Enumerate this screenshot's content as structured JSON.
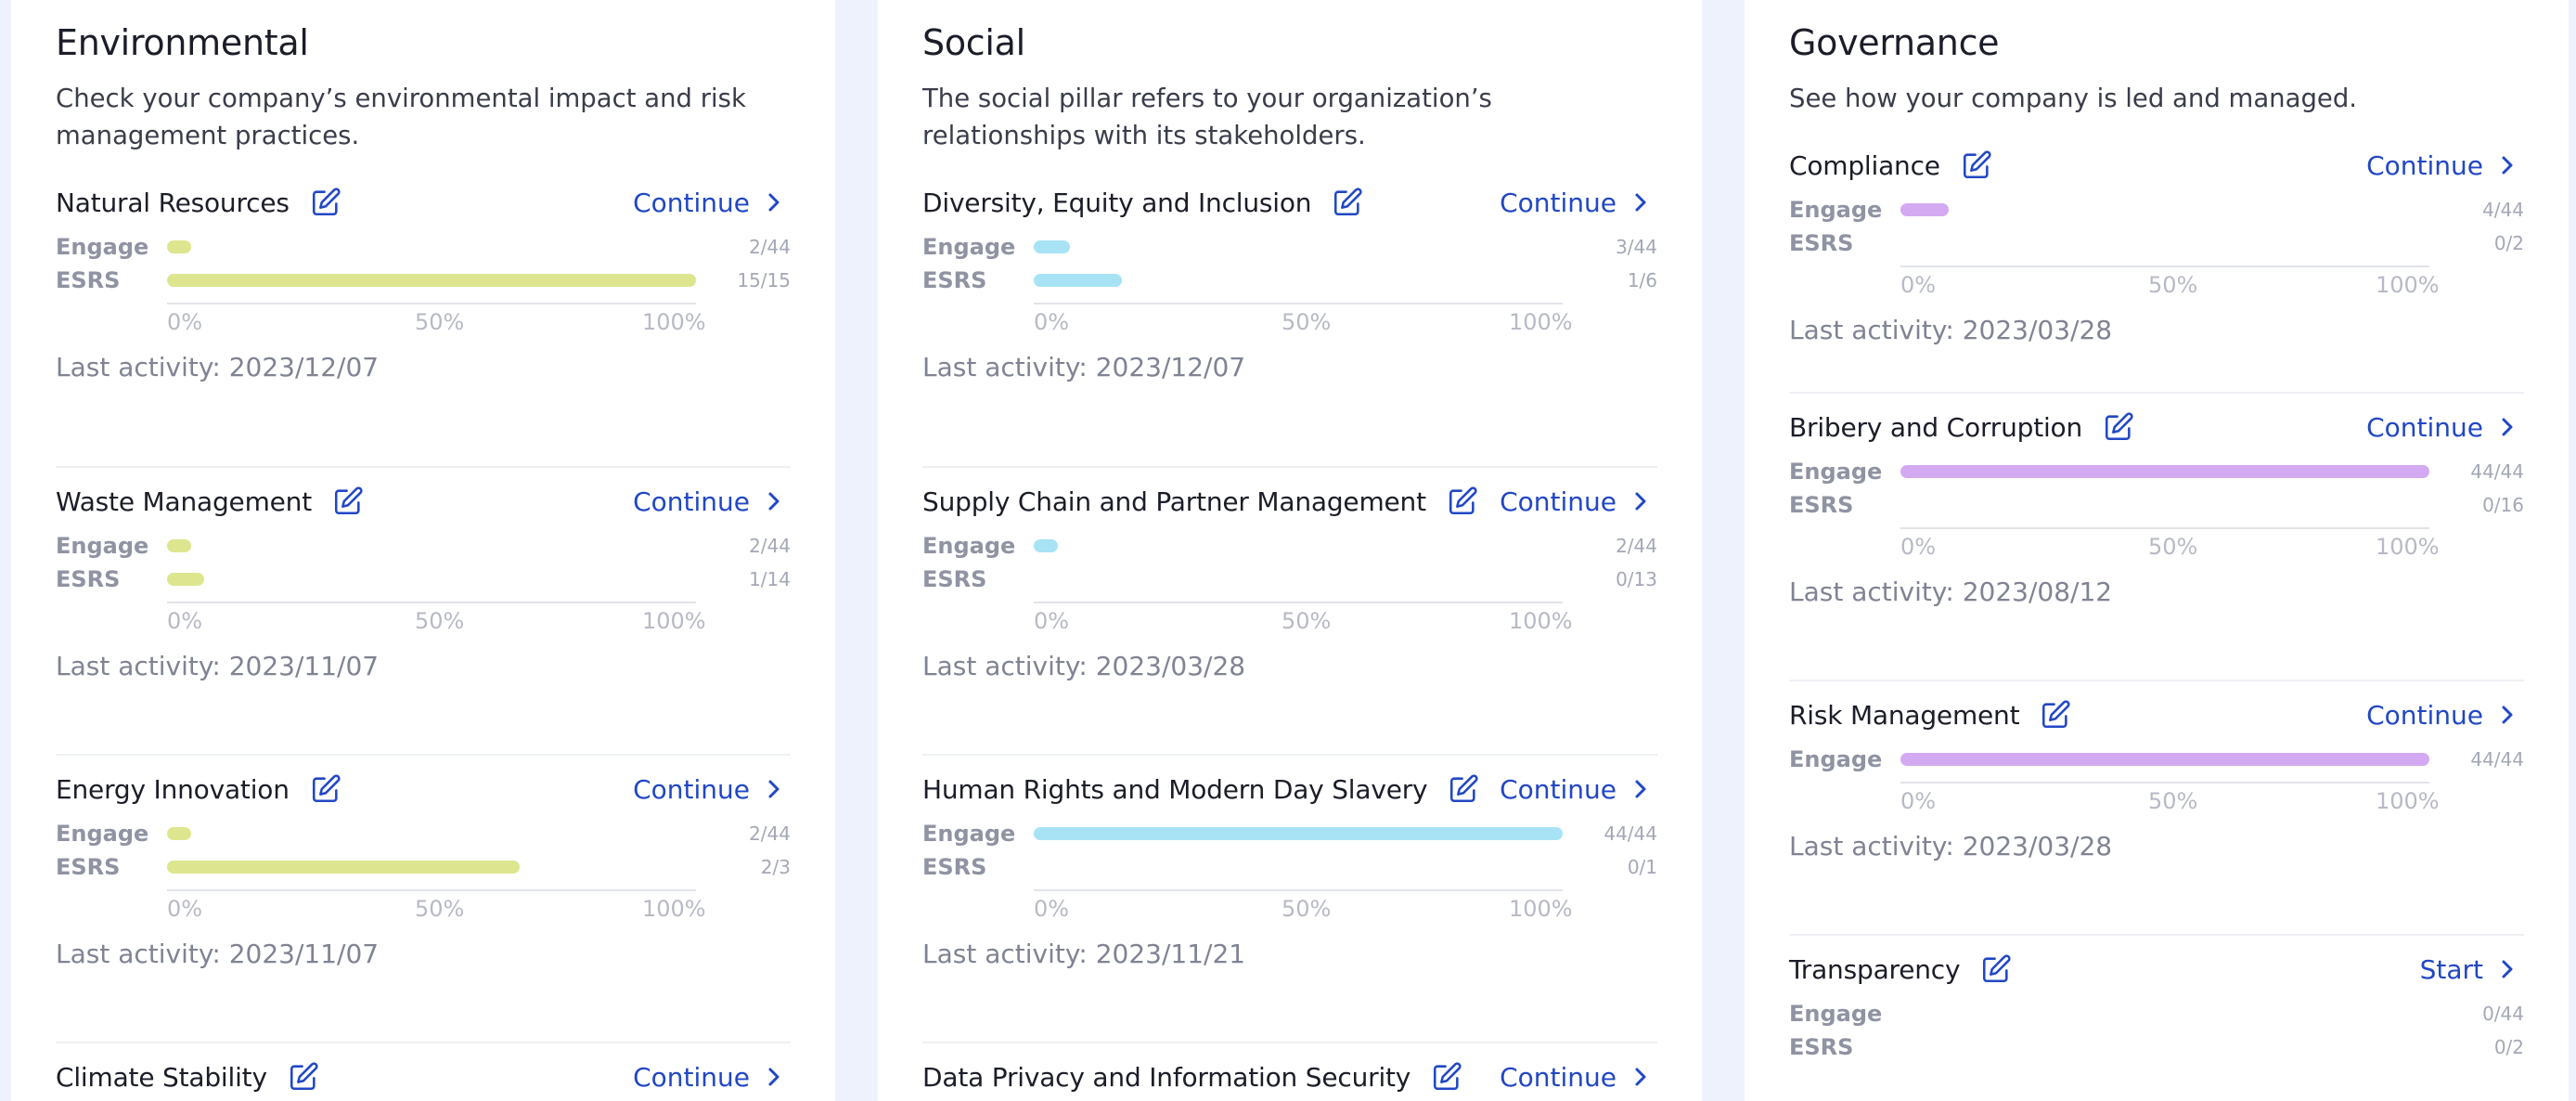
{
  "colors": {
    "environmental": "#dde68e",
    "social": "#a7e3f4",
    "governance": "#d3aaf2",
    "accent": "#2147c4"
  },
  "labels": {
    "engage": "Engage",
    "esrs": "ESRS",
    "last_activity_prefix": "Last activity: ",
    "ticks": [
      "0%",
      "50%",
      "100%"
    ]
  },
  "columns": [
    {
      "title": "Environmental",
      "description": "Check your company’s environmental impact and risk management practices.",
      "sections": [
        {
          "title": "Natural Resources",
          "action": "Continue",
          "engage": {
            "count": "2/44",
            "fraction": 0.045
          },
          "esrs": {
            "count": "15/15",
            "fraction": 1.0
          },
          "last_activity": "Last activity: 2023/12/07"
        },
        {
          "title": "Waste Management",
          "action": "Continue",
          "engage": {
            "count": "2/44",
            "fraction": 0.045
          },
          "esrs": {
            "count": "1/14",
            "fraction": 0.071
          },
          "last_activity": "Last activity: 2023/11/07"
        },
        {
          "title": "Energy Innovation",
          "action": "Continue",
          "engage": {
            "count": "2/44",
            "fraction": 0.045
          },
          "esrs": {
            "count": "2/3",
            "fraction": 0.667
          },
          "last_activity": "Last activity: 2023/11/07"
        },
        {
          "title": "Climate Stability",
          "action": "Continue"
        }
      ]
    },
    {
      "title": "Social",
      "description": "The social pillar refers to your organization’s relationships with its stakeholders.",
      "sections": [
        {
          "title": "Diversity, Equity and Inclusion",
          "action": "Continue",
          "engage": {
            "count": "3/44",
            "fraction": 0.068
          },
          "esrs": {
            "count": "1/6",
            "fraction": 0.167
          },
          "last_activity": "Last activity: 2023/12/07"
        },
        {
          "title": "Supply Chain and Partner Management",
          "action": "Continue",
          "engage": {
            "count": "2/44",
            "fraction": 0.045
          },
          "esrs": {
            "count": "0/13",
            "fraction": 0
          },
          "last_activity": "Last activity: 2023/03/28"
        },
        {
          "title": "Human Rights and Modern Day Slavery",
          "action": "Continue",
          "engage": {
            "count": "44/44",
            "fraction": 1.0
          },
          "esrs": {
            "count": "0/1",
            "fraction": 0
          },
          "last_activity": "Last activity: 2023/11/21"
        },
        {
          "title": "Data Privacy and Information Security",
          "action": "Continue"
        }
      ]
    },
    {
      "title": "Governance",
      "description": "See how your company is led and managed.",
      "sections": [
        {
          "title": "Compliance",
          "action": "Continue",
          "engage": {
            "count": "4/44",
            "fraction": 0.091
          },
          "esrs": {
            "count": "0/2",
            "fraction": 0
          },
          "last_activity": "Last activity: 2023/03/28"
        },
        {
          "title": "Bribery and Corruption",
          "action": "Continue",
          "engage": {
            "count": "44/44",
            "fraction": 1.0
          },
          "esrs": {
            "count": "0/16",
            "fraction": 0
          },
          "last_activity": "Last activity: 2023/08/12"
        },
        {
          "title": "Risk Management",
          "action": "Continue",
          "engage": {
            "count": "44/44",
            "fraction": 1.0
          },
          "last_activity": "Last activity: 2023/03/28"
        },
        {
          "title": "Transparency",
          "action": "Start",
          "engage": {
            "count": "0/44",
            "fraction": 0
          },
          "esrs": {
            "count": "0/2",
            "fraction": 0
          }
        }
      ]
    }
  ]
}
